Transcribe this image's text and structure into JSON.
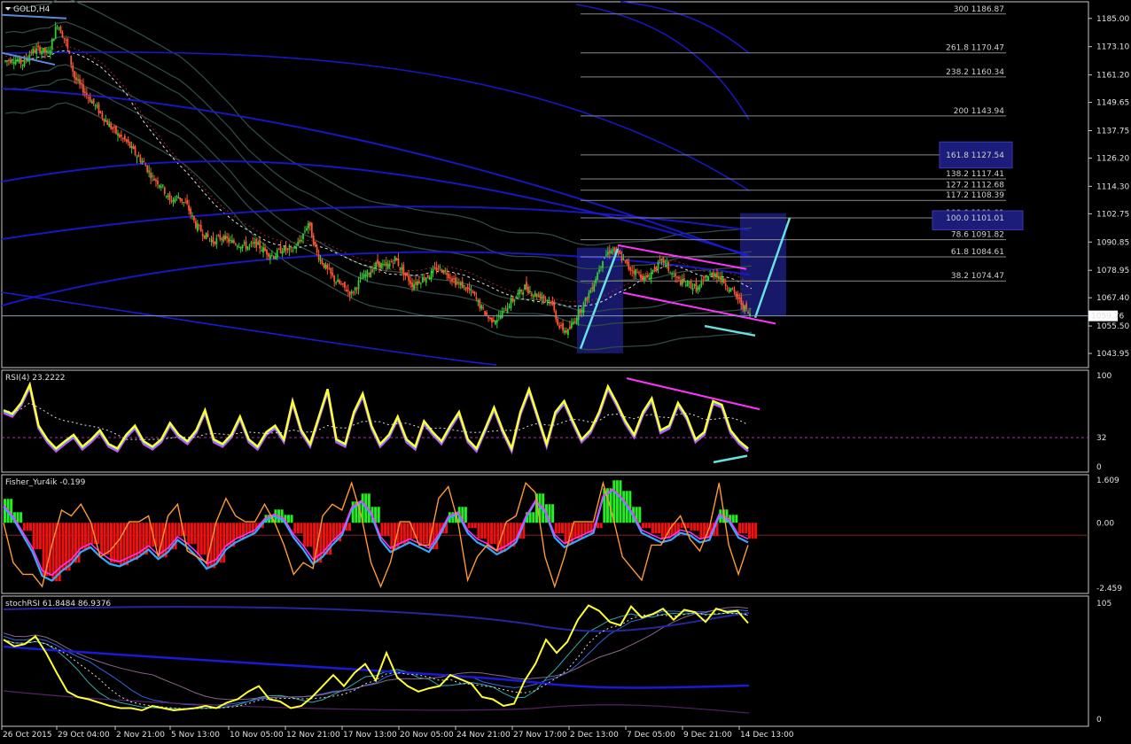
{
  "colors": {
    "background": "#000000",
    "frame": "#c8c8c8",
    "bull_candle": "#33cc33",
    "bear_candle": "#ff5533",
    "bollinger": "#2f4a44",
    "ma_blue": "#1a1ad6",
    "fib_line": "#8a8a8a",
    "fib_box": "#1c1c7a",
    "magenta": "#ff33ff",
    "cyan": "#66e0e0",
    "rsi_yellow": "#ffff33",
    "fisher_green": "#22ee22",
    "fisher_red": "#ee1111",
    "fisher_orange": "#ff9933"
  },
  "chart_data": [
    {
      "type": "candlestick",
      "title": "GOLD,H4",
      "ylim": [
        1038,
        1192
      ],
      "y_ticks": [
        "1185.00",
        "1173.10",
        "1161.20",
        "1149.65",
        "1137.75",
        "1126.20",
        "1114.30",
        "1102.75",
        "1090.85",
        "1078.95",
        "1067.40",
        "1055.50",
        "1043.95"
      ],
      "current_price": "1059.76",
      "fib_levels": [
        {
          "label": "300  1186.87",
          "value": 1186.87
        },
        {
          "label": "261.8  1170.47",
          "value": 1170.47
        },
        {
          "label": "238.2  1160.34",
          "value": 1160.34
        },
        {
          "label": "200  1143.94",
          "value": 1143.94
        },
        {
          "label": "161.8  1127.54",
          "value": 1127.54
        },
        {
          "label": "138.2  1117.41",
          "value": 1117.41
        },
        {
          "label": "127.2  1112.68",
          "value": 1112.68
        },
        {
          "label": "117.2  1108.39",
          "value": 1108.39
        },
        {
          "label": "100.0  1101.01",
          "value": 1101.01
        },
        {
          "label": "78.6  1091.82",
          "value": 1091.82
        },
        {
          "label": "61.8  1084.61",
          "value": 1084.61
        },
        {
          "label": "38.2  1074.47",
          "value": 1074.47
        }
      ],
      "x_labels": [
        "26 Oct 2015",
        "29 Oct 04:00",
        "2 Nov 21:00",
        "5 Nov 13:00",
        "10 Nov 05:00",
        "12 Nov 21:00",
        "17 Nov 13:00",
        "20 Nov 05:00",
        "24 Nov 21:00",
        "27 Nov 17:00",
        "2 Dec 13:00",
        "7 Dec 05:00",
        "9 Dec 21:00",
        "14 Dec 13:00"
      ],
      "close_path": [
        1167,
        1168,
        1166,
        1171,
        1172,
        1170,
        1183,
        1175,
        1160,
        1155,
        1150,
        1145,
        1140,
        1136,
        1133,
        1128,
        1124,
        1118,
        1115,
        1108,
        1110,
        1106,
        1098,
        1094,
        1091,
        1093,
        1091,
        1090,
        1089,
        1090,
        1087,
        1085,
        1088,
        1087,
        1091,
        1099,
        1086,
        1080,
        1075,
        1072,
        1069,
        1075,
        1078,
        1082,
        1080,
        1084,
        1078,
        1073,
        1075,
        1077,
        1080,
        1078,
        1074,
        1072,
        1069,
        1063,
        1058,
        1059,
        1064,
        1068,
        1072,
        1069,
        1068,
        1066,
        1055,
        1053,
        1060,
        1066,
        1074,
        1084,
        1088,
        1085,
        1080,
        1078,
        1075,
        1080,
        1083,
        1077,
        1074,
        1073,
        1071,
        1076,
        1078,
        1074,
        1070,
        1065,
        1060
      ]
    },
    {
      "type": "line",
      "title": "RSI(4) 23.2222",
      "ylim": [
        0,
        100
      ],
      "y_ticks": [
        "100",
        "32",
        "0"
      ],
      "level": 32,
      "values": [
        62,
        58,
        70,
        90,
        45,
        30,
        20,
        28,
        35,
        22,
        30,
        40,
        25,
        20,
        35,
        45,
        28,
        22,
        30,
        48,
        35,
        28,
        40,
        62,
        30,
        25,
        35,
        55,
        30,
        22,
        38,
        45,
        30,
        72,
        40,
        25,
        55,
        85,
        30,
        25,
        60,
        80,
        45,
        25,
        35,
        55,
        30,
        22,
        50,
        38,
        28,
        45,
        60,
        30,
        20,
        42,
        65,
        40,
        20,
        60,
        85,
        55,
        25,
        60,
        72,
        50,
        30,
        40,
        60,
        88,
        70,
        50,
        35,
        60,
        75,
        40,
        45,
        70,
        55,
        30,
        38,
        72,
        68,
        40,
        28,
        20
      ]
    },
    {
      "type": "histogram",
      "title": "Fisher_Yur4ik -0.199",
      "ylim": [
        -2.459,
        1.609
      ],
      "y_ticks": [
        "1.609",
        "0.00",
        "-2.459"
      ],
      "values": [
        0.9,
        0.4,
        -0.3,
        -1.0,
        -2.0,
        -2.2,
        -1.8,
        -1.5,
        -1.0,
        -0.8,
        -1.2,
        -1.5,
        -1.6,
        -1.4,
        -1.2,
        -0.9,
        -1.3,
        -1.0,
        -0.5,
        -0.8,
        -1.2,
        -1.7,
        -1.5,
        -0.9,
        -0.6,
        -0.4,
        -0.2,
        0.3,
        0.5,
        0.3,
        -0.4,
        -0.9,
        -1.5,
        -1.2,
        -0.7,
        -0.3,
        0.8,
        1.1,
        0.6,
        -0.5,
        -1.0,
        -0.8,
        -0.6,
        -0.8,
        -1.0,
        -0.4,
        0.4,
        0.6,
        -0.2,
        -0.6,
        -0.8,
        -1.1,
        -0.9,
        -0.6,
        0.4,
        1.1,
        0.7,
        -0.4,
        -0.8,
        -0.6,
        -0.4,
        -0.2,
        1.3,
        1.6,
        1.2,
        0.6,
        -0.2,
        -0.4,
        -0.6,
        -0.5,
        -0.2,
        -0.3,
        -0.6,
        -0.5,
        0.5,
        0.3,
        -0.4,
        -0.6
      ]
    },
    {
      "type": "line",
      "title": "stochRSI 61.8484 86.9376",
      "ylim": [
        0,
        105
      ],
      "y_ticks": [
        "105",
        "0"
      ],
      "values": [
        72,
        66,
        68,
        75,
        60,
        42,
        25,
        20,
        18,
        15,
        12,
        10,
        10,
        8,
        12,
        10,
        8,
        9,
        10,
        12,
        10,
        15,
        18,
        25,
        30,
        18,
        16,
        10,
        12,
        20,
        30,
        40,
        30,
        42,
        50,
        35,
        60,
        38,
        30,
        25,
        28,
        30,
        40,
        36,
        32,
        20,
        18,
        12,
        14,
        35,
        50,
        72,
        60,
        70,
        90,
        103,
        98,
        88,
        85,
        102,
        92,
        95,
        100,
        90,
        99,
        97,
        88,
        100,
        97,
        98,
        87
      ]
    }
  ]
}
